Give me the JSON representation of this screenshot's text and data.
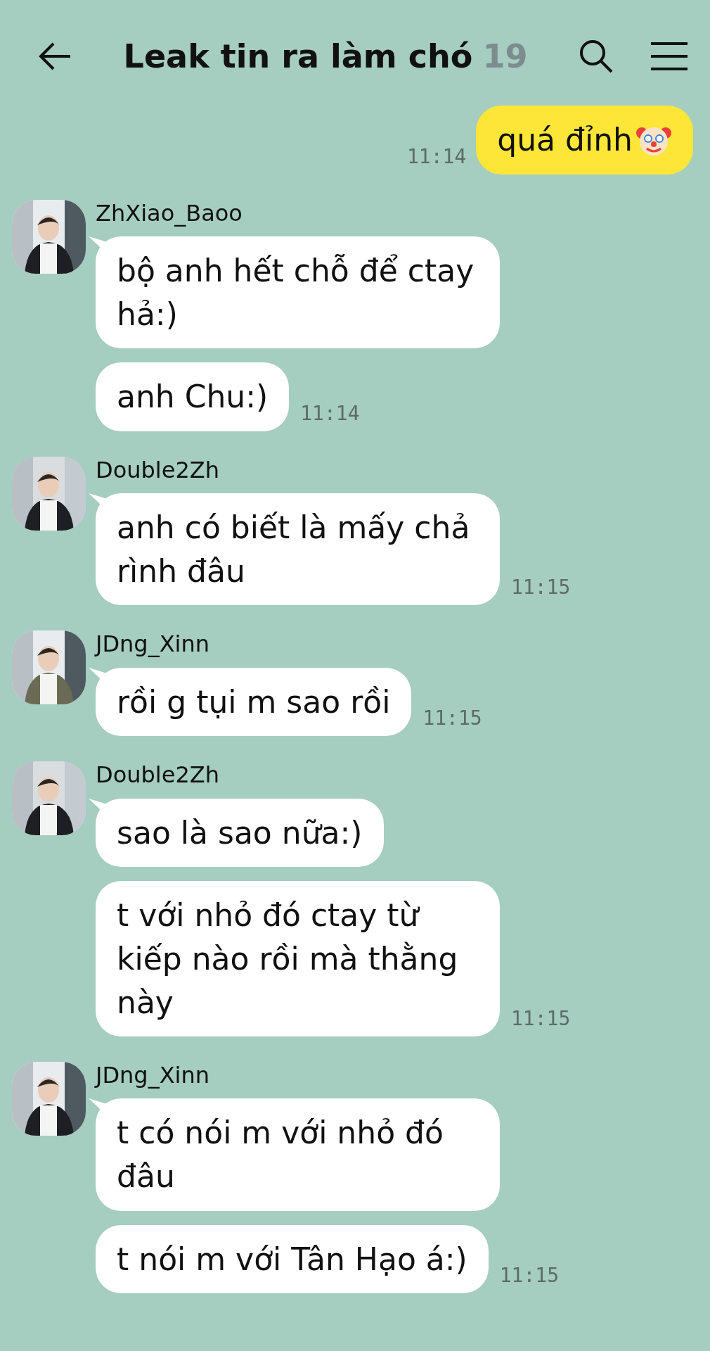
{
  "header": {
    "title": "Leak tin ra làm chó",
    "member_count": "19"
  },
  "messages": [
    {
      "kind": "sent",
      "text": "quá đỉnh",
      "time": "11:14"
    },
    {
      "kind": "received",
      "sender": "ZhXiao_Baoo",
      "avatar": {
        "kind": "picture"
      },
      "bubbles": [
        {
          "text": "bộ anh hết chỗ để ctay hả:)"
        },
        {
          "text": "anh Chu:)",
          "time": "11:14"
        }
      ]
    },
    {
      "kind": "received",
      "sender": "Double2Zh",
      "avatar": {
        "kind": "picture"
      },
      "bubbles": [
        {
          "text": "anh có biết là mấy chả rình đâu",
          "time": "11:15"
        }
      ]
    },
    {
      "kind": "received",
      "sender": "JDng_Xinn",
      "avatar": {
        "kind": "picture"
      },
      "bubbles": [
        {
          "text": "rồi g tụi m sao rồi",
          "time": "11:15"
        }
      ]
    },
    {
      "kind": "received",
      "sender": "Double2Zh",
      "avatar": {
        "kind": "picture"
      },
      "bubbles": [
        {
          "text": "sao là sao nữa:)"
        },
        {
          "text": "t với nhỏ đó ctay từ kiếp nào rồi mà thằng này",
          "time": "11:15"
        }
      ]
    },
    {
      "kind": "received",
      "sender": "JDng_Xinn",
      "avatar": {
        "kind": "picture"
      },
      "bubbles": [
        {
          "text": "t có nói m với nhỏ đó đâu"
        },
        {
          "text": "t nói m với Tân Hạo á:)",
          "time": "11:15"
        }
      ]
    }
  ]
}
